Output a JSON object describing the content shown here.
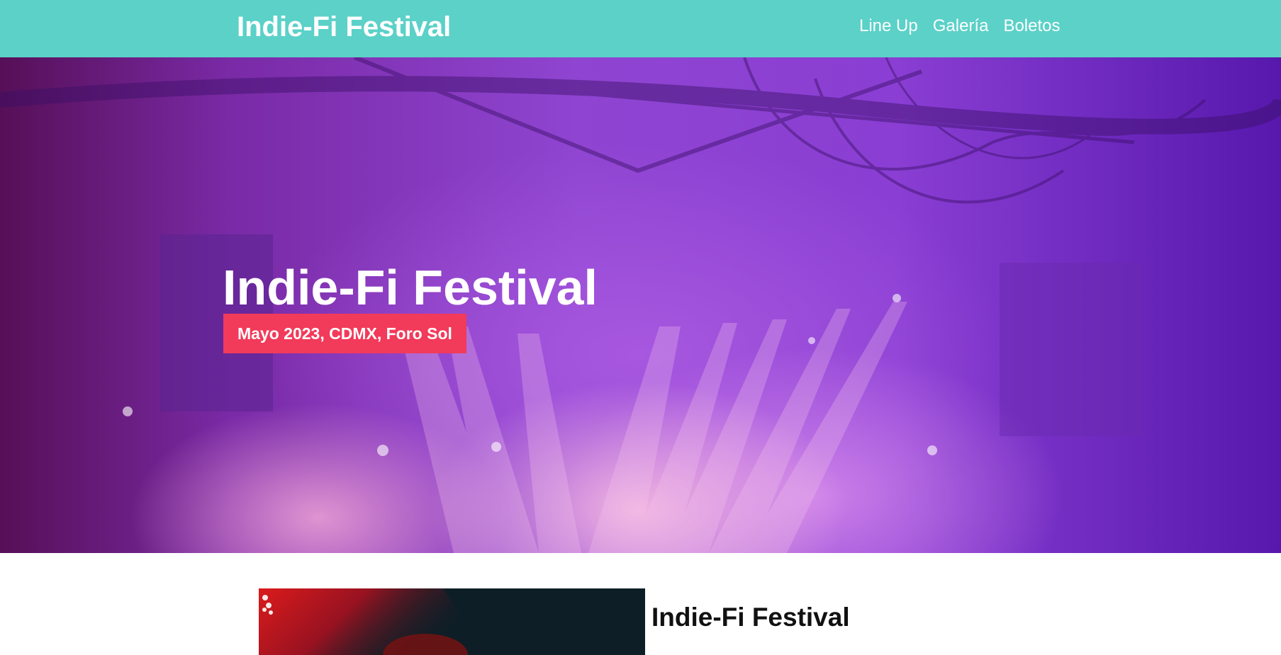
{
  "header": {
    "logo": "Indie-Fi Festival",
    "nav": [
      {
        "label": "Line Up"
      },
      {
        "label": "Galería"
      },
      {
        "label": "Boletos"
      }
    ]
  },
  "hero": {
    "title": "Indie-Fi Festival",
    "subtitle": "Mayo 2023, CDMX, Foro Sol"
  },
  "content": {
    "title": "Indie-Fi Festival"
  },
  "colors": {
    "header_bg": "#5bd1c8",
    "badge_bg": "#f23a5a",
    "hero_tint": "#8f45d1"
  }
}
